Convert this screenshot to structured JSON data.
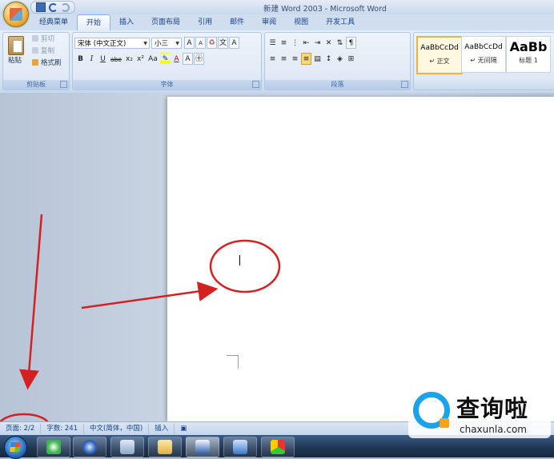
{
  "window": {
    "title": "新建 Word 2003 - Microsoft Word"
  },
  "tabs": [
    "经典菜单",
    "开始",
    "插入",
    "页面布局",
    "引用",
    "邮件",
    "审阅",
    "视图",
    "开发工具"
  ],
  "clipboard": {
    "paste": "粘贴",
    "cut": "剪切",
    "copy": "复制",
    "format_painter": "格式刷",
    "group_label": "剪贴板"
  },
  "font": {
    "name": "宋体 (中文正文)",
    "size": "小三",
    "grow": "A",
    "shrink": "A",
    "group_label": "字体",
    "bold": "B",
    "italic": "I",
    "underline": "U",
    "strike": "abe",
    "sub": "x₂",
    "sup": "x²",
    "case": "Aa"
  },
  "paragraph": {
    "group_label": "段落"
  },
  "styles": [
    {
      "preview": "AaBbCcDd",
      "name": "↵ 正文"
    },
    {
      "preview": "AaBbCcDd",
      "name": "↵ 无间隔"
    },
    {
      "preview": "AaBb",
      "name": "标题 1"
    }
  ],
  "status": {
    "page": "页面: 2/2",
    "words": "字数: 241",
    "lang": "中文(简体，中国)",
    "mode": "插入"
  },
  "watermark": {
    "cn": "查询啦",
    "en": "chaxunla.com"
  },
  "colors": {
    "annotation": "#d42020",
    "accent": "#1aa3e8"
  }
}
